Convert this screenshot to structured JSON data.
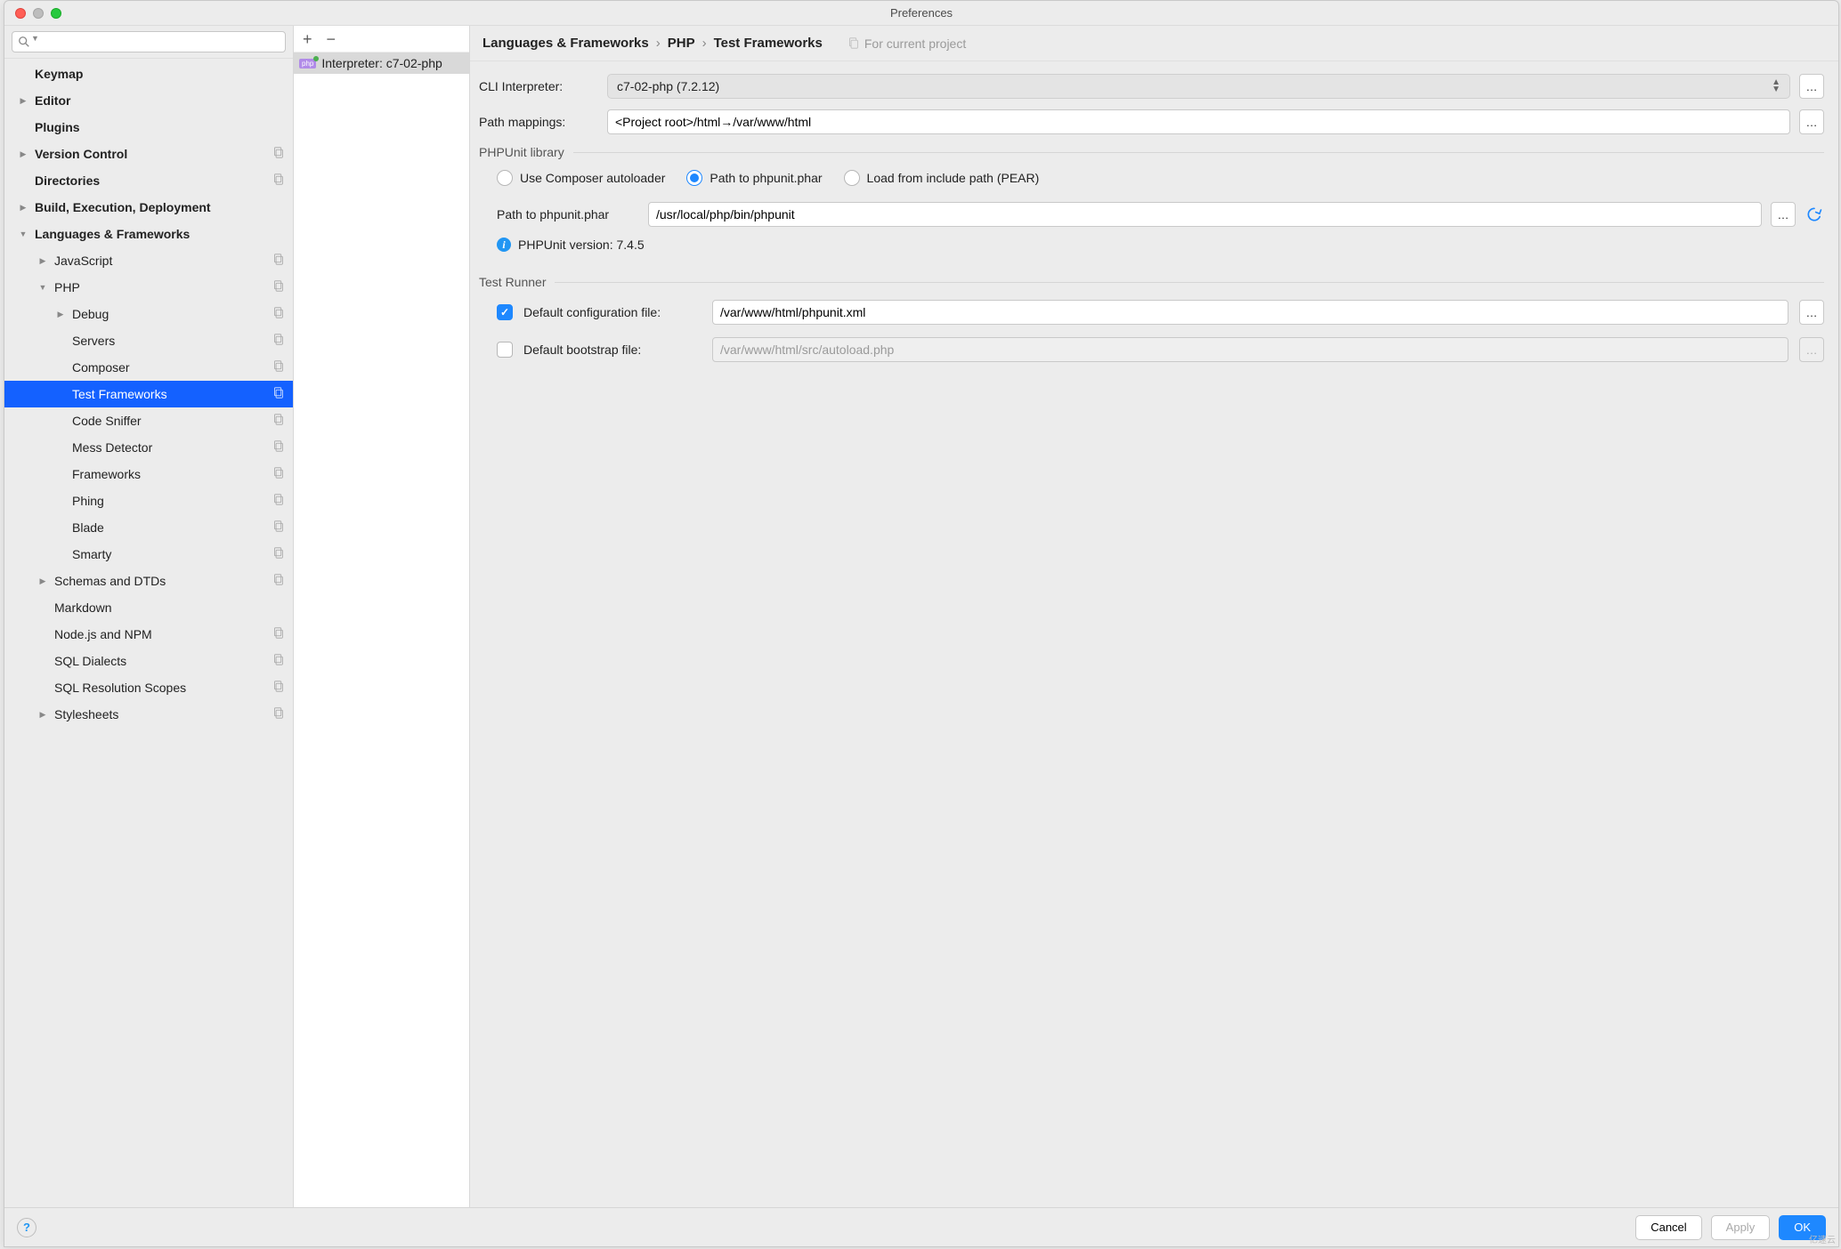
{
  "window": {
    "title": "Preferences"
  },
  "sidebar": {
    "search_placeholder": "",
    "items": [
      {
        "label": "Keymap",
        "depth": 1,
        "bold": true
      },
      {
        "label": "Editor",
        "depth": 1,
        "bold": true,
        "arrow": "right"
      },
      {
        "label": "Plugins",
        "depth": 1,
        "bold": true
      },
      {
        "label": "Version Control",
        "depth": 1,
        "bold": true,
        "arrow": "right",
        "copy": true
      },
      {
        "label": "Directories",
        "depth": 1,
        "bold": true,
        "copy": true
      },
      {
        "label": "Build, Execution, Deployment",
        "depth": 1,
        "bold": true,
        "arrow": "right"
      },
      {
        "label": "Languages & Frameworks",
        "depth": 1,
        "bold": true,
        "arrow": "down"
      },
      {
        "label": "JavaScript",
        "depth": 2,
        "arrow": "right",
        "copy": true
      },
      {
        "label": "PHP",
        "depth": 2,
        "arrow": "down",
        "copy": true
      },
      {
        "label": "Debug",
        "depth": 3,
        "arrow": "right",
        "copy": true
      },
      {
        "label": "Servers",
        "depth": 3,
        "copy": true
      },
      {
        "label": "Composer",
        "depth": 3,
        "copy": true
      },
      {
        "label": "Test Frameworks",
        "depth": 3,
        "copy": true,
        "selected": true
      },
      {
        "label": "Code Sniffer",
        "depth": 3,
        "copy": true
      },
      {
        "label": "Mess Detector",
        "depth": 3,
        "copy": true
      },
      {
        "label": "Frameworks",
        "depth": 3,
        "copy": true
      },
      {
        "label": "Phing",
        "depth": 3,
        "copy": true
      },
      {
        "label": "Blade",
        "depth": 3,
        "copy": true
      },
      {
        "label": "Smarty",
        "depth": 3,
        "copy": true
      },
      {
        "label": "Schemas and DTDs",
        "depth": 2,
        "arrow": "right",
        "copy": true
      },
      {
        "label": "Markdown",
        "depth": 2
      },
      {
        "label": "Node.js and NPM",
        "depth": 2,
        "copy": true
      },
      {
        "label": "SQL Dialects",
        "depth": 2,
        "copy": true
      },
      {
        "label": "SQL Resolution Scopes",
        "depth": 2,
        "copy": true
      },
      {
        "label": "Stylesheets",
        "depth": 2,
        "arrow": "right",
        "copy": true
      }
    ]
  },
  "midlist": {
    "toolbar": {
      "add": "+",
      "remove": "−"
    },
    "item_badge": "php",
    "item_label": "Interpreter: c7-02-php"
  },
  "breadcrumb": {
    "a": "Languages & Frameworks",
    "b": "PHP",
    "c": "Test Frameworks",
    "hint": "For current project"
  },
  "cli": {
    "label": "CLI Interpreter:",
    "value": "c7-02-php (7.2.12)"
  },
  "path_mappings": {
    "label": "Path mappings:",
    "value": "<Project root>/html→/var/www/html"
  },
  "section_library": "PHPUnit library",
  "radios": {
    "composer": "Use Composer autoloader",
    "phar": "Path to phpunit.phar",
    "pear": "Load from include path (PEAR)"
  },
  "phar_path": {
    "label": "Path to phpunit.phar",
    "value": "/usr/local/php/bin/phpunit"
  },
  "phpunit_info": "PHPUnit version: 7.4.5",
  "section_runner": "Test Runner",
  "config_file": {
    "label": "Default configuration file:",
    "value": "/var/www/html/phpunit.xml"
  },
  "bootstrap_file": {
    "label": "Default bootstrap file:",
    "value": "/var/www/html/src/autoload.php"
  },
  "footer": {
    "cancel": "Cancel",
    "apply": "Apply",
    "ok": "OK"
  },
  "watermark": "亿速云"
}
